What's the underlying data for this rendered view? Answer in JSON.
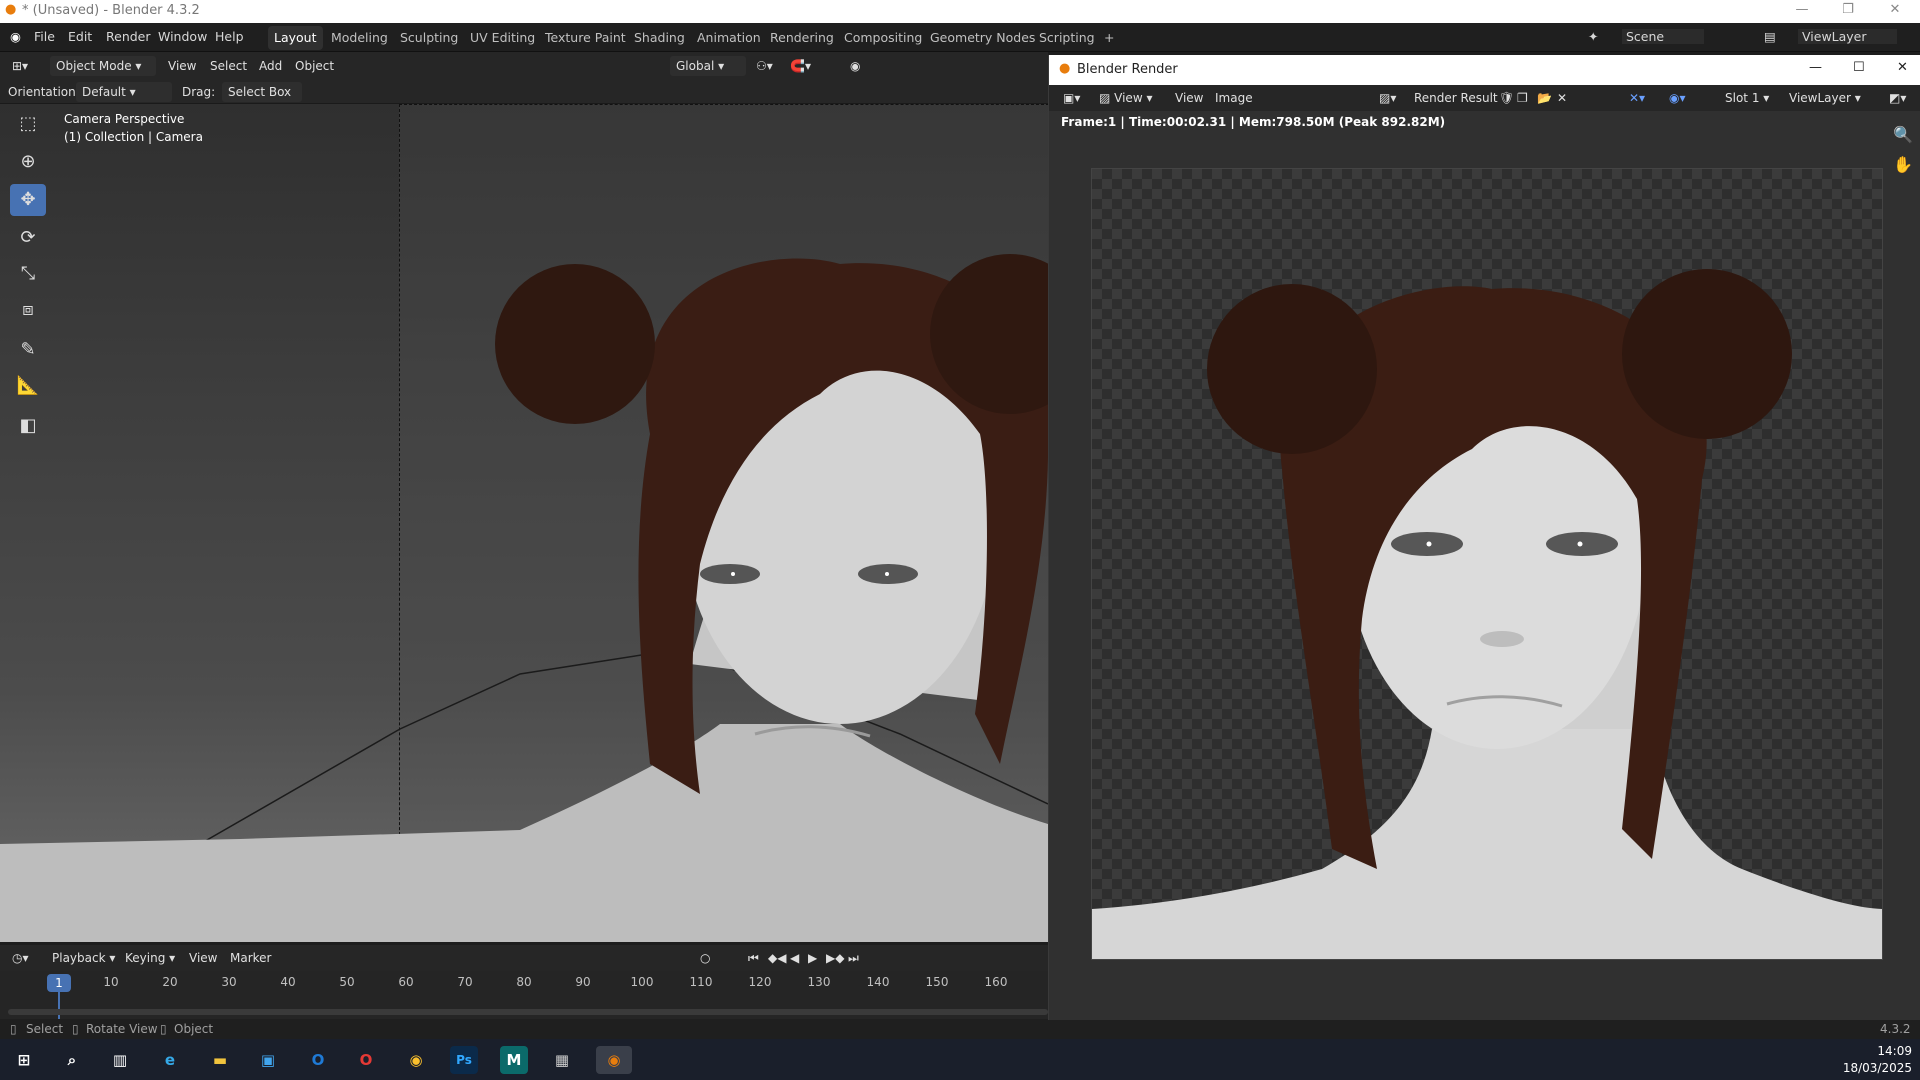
{
  "window": {
    "title": "* (Unsaved) - Blender 4.3.2"
  },
  "menu": {
    "items": [
      "File",
      "Edit",
      "Render",
      "Window",
      "Help"
    ]
  },
  "workspaces": {
    "tabs": [
      "Layout",
      "Modeling",
      "Sculpting",
      "UV Editing",
      "Texture Paint",
      "Shading",
      "Animation",
      "Rendering",
      "Compositing",
      "Geometry Nodes",
      "Scripting"
    ],
    "add": "+",
    "active": "Layout"
  },
  "scene": {
    "name": "Scene",
    "view_layer": "ViewLayer"
  },
  "viewport_header": {
    "mode": "Object Mode",
    "view": "View",
    "select": "Select",
    "add": "Add",
    "object": "Object",
    "transform": "Global"
  },
  "tool_settings": {
    "orientation_label": "Orientation:",
    "orientation": "Default",
    "drag_label": "Drag:",
    "drag": "Select Box"
  },
  "viewport": {
    "line1": "Camera Perspective",
    "line2": "(1) Collection | Camera"
  },
  "timeline": {
    "playback": "Playback",
    "keying": "Keying",
    "view": "View",
    "marker": "Marker",
    "current_frame": "1",
    "ticks": [
      "10",
      "20",
      "30",
      "40",
      "50",
      "60",
      "70",
      "80",
      "90",
      "100",
      "110",
      "120",
      "130",
      "140",
      "150",
      "160"
    ]
  },
  "status": {
    "select": "Select",
    "rotate": "Rotate View",
    "object": "Object",
    "version": "4.3.2"
  },
  "render_window": {
    "title": "Blender Render",
    "view": "View",
    "view2": "View",
    "image": "Image",
    "result": "Render Result",
    "slot": "Slot 1",
    "layer": "ViewLayer",
    "info": "Frame:1 | Time:00:02.31 | Mem:798.50M (Peak 892.82M)"
  },
  "taskbar": {
    "time": "14:09",
    "date": "18/03/2025"
  }
}
